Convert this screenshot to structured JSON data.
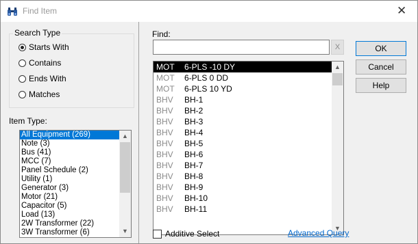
{
  "window": {
    "title": "Find Item"
  },
  "search_type": {
    "legend": "Search Type",
    "options": [
      "Starts With",
      "Contains",
      "Ends With",
      "Matches"
    ],
    "selected": "Starts With"
  },
  "item_type": {
    "label": "Item Type:",
    "items": [
      "All Equipment  (269)",
      "Note  (3)",
      "Bus  (41)",
      "MCC  (7)",
      "Panel Schedule  (2)",
      "Utility  (1)",
      "Generator  (3)",
      "Motor  (21)",
      "Capacitor  (5)",
      "Load  (13)",
      "2W Transformer  (22)",
      "3W Transformer  (6)"
    ],
    "selected": "All Equipment  (269)"
  },
  "find": {
    "label": "Find:",
    "value": "",
    "clear_label": "X"
  },
  "results": [
    {
      "type": "MOT",
      "name": "6-PLS -10 DY"
    },
    {
      "type": "MOT",
      "name": "6-PLS 0 DD"
    },
    {
      "type": "MOT",
      "name": "6-PLS 10 YD"
    },
    {
      "type": "BHV",
      "name": "BH-1"
    },
    {
      "type": "BHV",
      "name": "BH-2"
    },
    {
      "type": "BHV",
      "name": "BH-3"
    },
    {
      "type": "BHV",
      "name": "BH-4"
    },
    {
      "type": "BHV",
      "name": "BH-5"
    },
    {
      "type": "BHV",
      "name": "BH-6"
    },
    {
      "type": "BHV",
      "name": "BH-7"
    },
    {
      "type": "BHV",
      "name": "BH-8"
    },
    {
      "type": "BHV",
      "name": "BH-9"
    },
    {
      "type": "BHV",
      "name": "BH-10"
    },
    {
      "type": "BHV",
      "name": "BH-11"
    }
  ],
  "selected_result": "6-PLS -10 DY",
  "buttons": {
    "ok": "OK",
    "cancel": "Cancel",
    "help": "Help"
  },
  "additive_select": {
    "label": "Additive Select",
    "checked": false
  },
  "advanced_query_label": "Advanced Query",
  "colors": {
    "accent": "#0078d7",
    "link": "#0066cc",
    "selection_dark": "#000000"
  }
}
